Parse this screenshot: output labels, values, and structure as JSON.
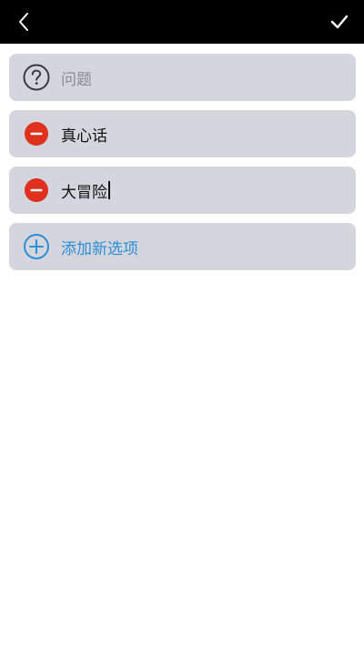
{
  "header": {
    "back_icon": "chevron-left-icon",
    "confirm_icon": "checkmark-icon"
  },
  "question": {
    "icon": "question-circle-icon",
    "placeholder": "问题"
  },
  "options": [
    {
      "icon": "remove-circle-icon",
      "value": "真心话"
    },
    {
      "icon": "remove-circle-icon",
      "value": "大冒险"
    }
  ],
  "add_option": {
    "icon": "add-circle-icon",
    "label": "添加新选项"
  },
  "colors": {
    "header_bg": "#000000",
    "card_bg": "#d5d5de",
    "remove_red": "#e0301e",
    "accent_blue": "#2a8fd6",
    "placeholder_gray": "#8a8a90"
  }
}
